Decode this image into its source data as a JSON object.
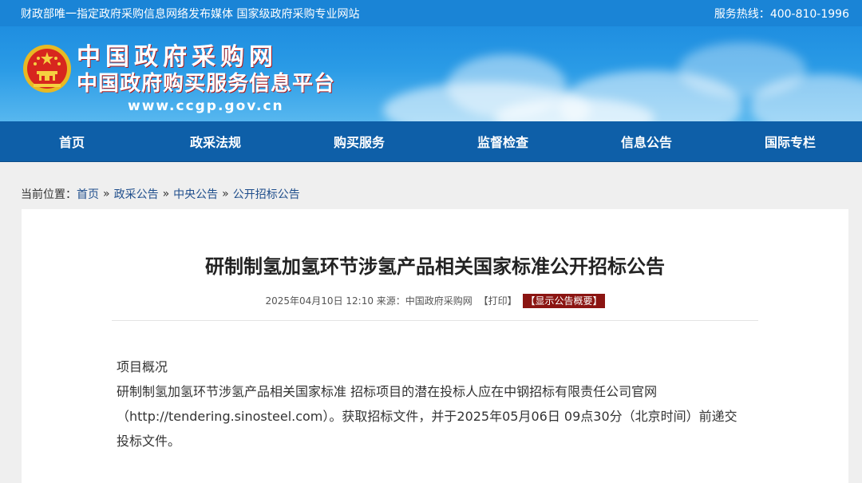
{
  "topbar": {
    "slogan": "财政部唯一指定政府采购信息网络发布媒体 国家级政府采购专业网站",
    "hotline_label": "服务热线：",
    "hotline_number": "400-810-1996"
  },
  "header": {
    "logo_line1": "中国政府采购网",
    "logo_line2": "中国政府购买服务信息平台",
    "logo_url": "www.ccgp.gov.cn"
  },
  "nav": {
    "items": [
      {
        "label": "首页"
      },
      {
        "label": "政采法规"
      },
      {
        "label": "购买服务"
      },
      {
        "label": "监督检查"
      },
      {
        "label": "信息公告"
      },
      {
        "label": "国际专栏"
      }
    ]
  },
  "breadcrumb": {
    "prefix": "当前位置：",
    "items": [
      "首页",
      "政采公告",
      "中央公告",
      "公开招标公告"
    ],
    "separator": "»"
  },
  "article": {
    "title": "研制制氢加氢环节涉氢产品相关国家标准公开招标公告",
    "meta_date": "2025年04月10日 12:10",
    "meta_source": "来源：中国政府采购网",
    "print_label": "【打印】",
    "summary_label": "【显示公告概要】",
    "section_heading": "项目概况",
    "paragraph_line1": "研制制氢加氢环节涉氢产品相关国家标准 招标项目的潜在投标人应在中钢招标有限责任公司官网",
    "paragraph_line2": "（http://tendering.sinosteel.com）。获取招标文件，并于2025年05月06日 09点30分（北京时间）前递交",
    "paragraph_line3": "投标文件。"
  },
  "colors": {
    "topbar_bg": "#1a84d6",
    "nav_bg": "#0e5fa8",
    "summary_badge_bg": "#8b1512",
    "breadcrumb_link": "#1f4e8c"
  }
}
